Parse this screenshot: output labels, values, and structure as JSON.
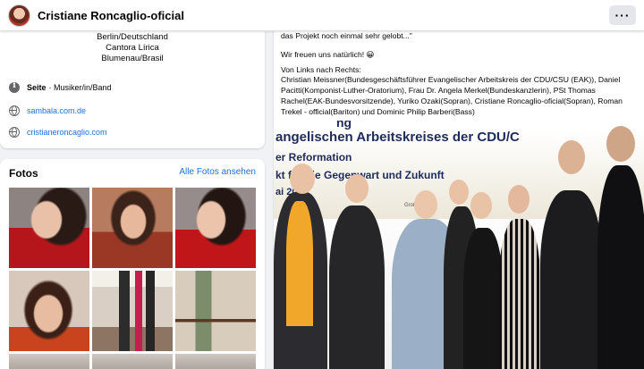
{
  "header": {
    "page_name": "Cristiane Roncaglio-oficial",
    "more_icon": "more-dots-icon",
    "more_label": "···"
  },
  "intro": {
    "lines": [
      "Berlin/Deutschland",
      "Cantora Lírica",
      "Blumenau/Brasil"
    ],
    "category_label": "Seite",
    "category_value": " · Musiker/in/Band",
    "website_1": "sambala.com.de",
    "website_2": "cristianeroncaglio.com"
  },
  "photos": {
    "title": "Fotos",
    "see_all": "Alle Fotos ansehen"
  },
  "post": {
    "line_top": "das Projekt noch einmal sehr gelobt...\"",
    "line_joy": "Wir freuen uns natürlich! 😀",
    "line_from": "Von Links nach Rechts:",
    "line_people_1": "Christian Meissner(Bundesgeschäftsführer Evangelischer Arbeitskreis der CDU/CSU (EAK)), Daniel",
    "line_people_2": "Pacitti(Komponist-Luther-Oratorium), Frau Dr. Angela Merkel(Bundeskanzlerin), PSt Thomas",
    "line_people_3": "Rachel(EAK-Bundesvorsitzende), Yuriko Ozaki(Sopran), Cristiane Roncaglio-oficial(Sopran), Roman",
    "line_people_4": "Trekel - official(Bariton) und Dominic Philip Barberi(Bass)"
  },
  "photo_banner": {
    "line_1": "ng",
    "line_2": "angelischen Arbeitskreises der CDU/C",
    "line_3": "er Reformation",
    "line_4": "kt für die Gegenwart und Zukunft",
    "line_5": "ai 2017",
    "sign": "Großer EAK"
  },
  "colors": {
    "accent_link": "#216fdb",
    "banner_text": "#1d2a5c",
    "banner_stripe": "#f5c21a"
  }
}
